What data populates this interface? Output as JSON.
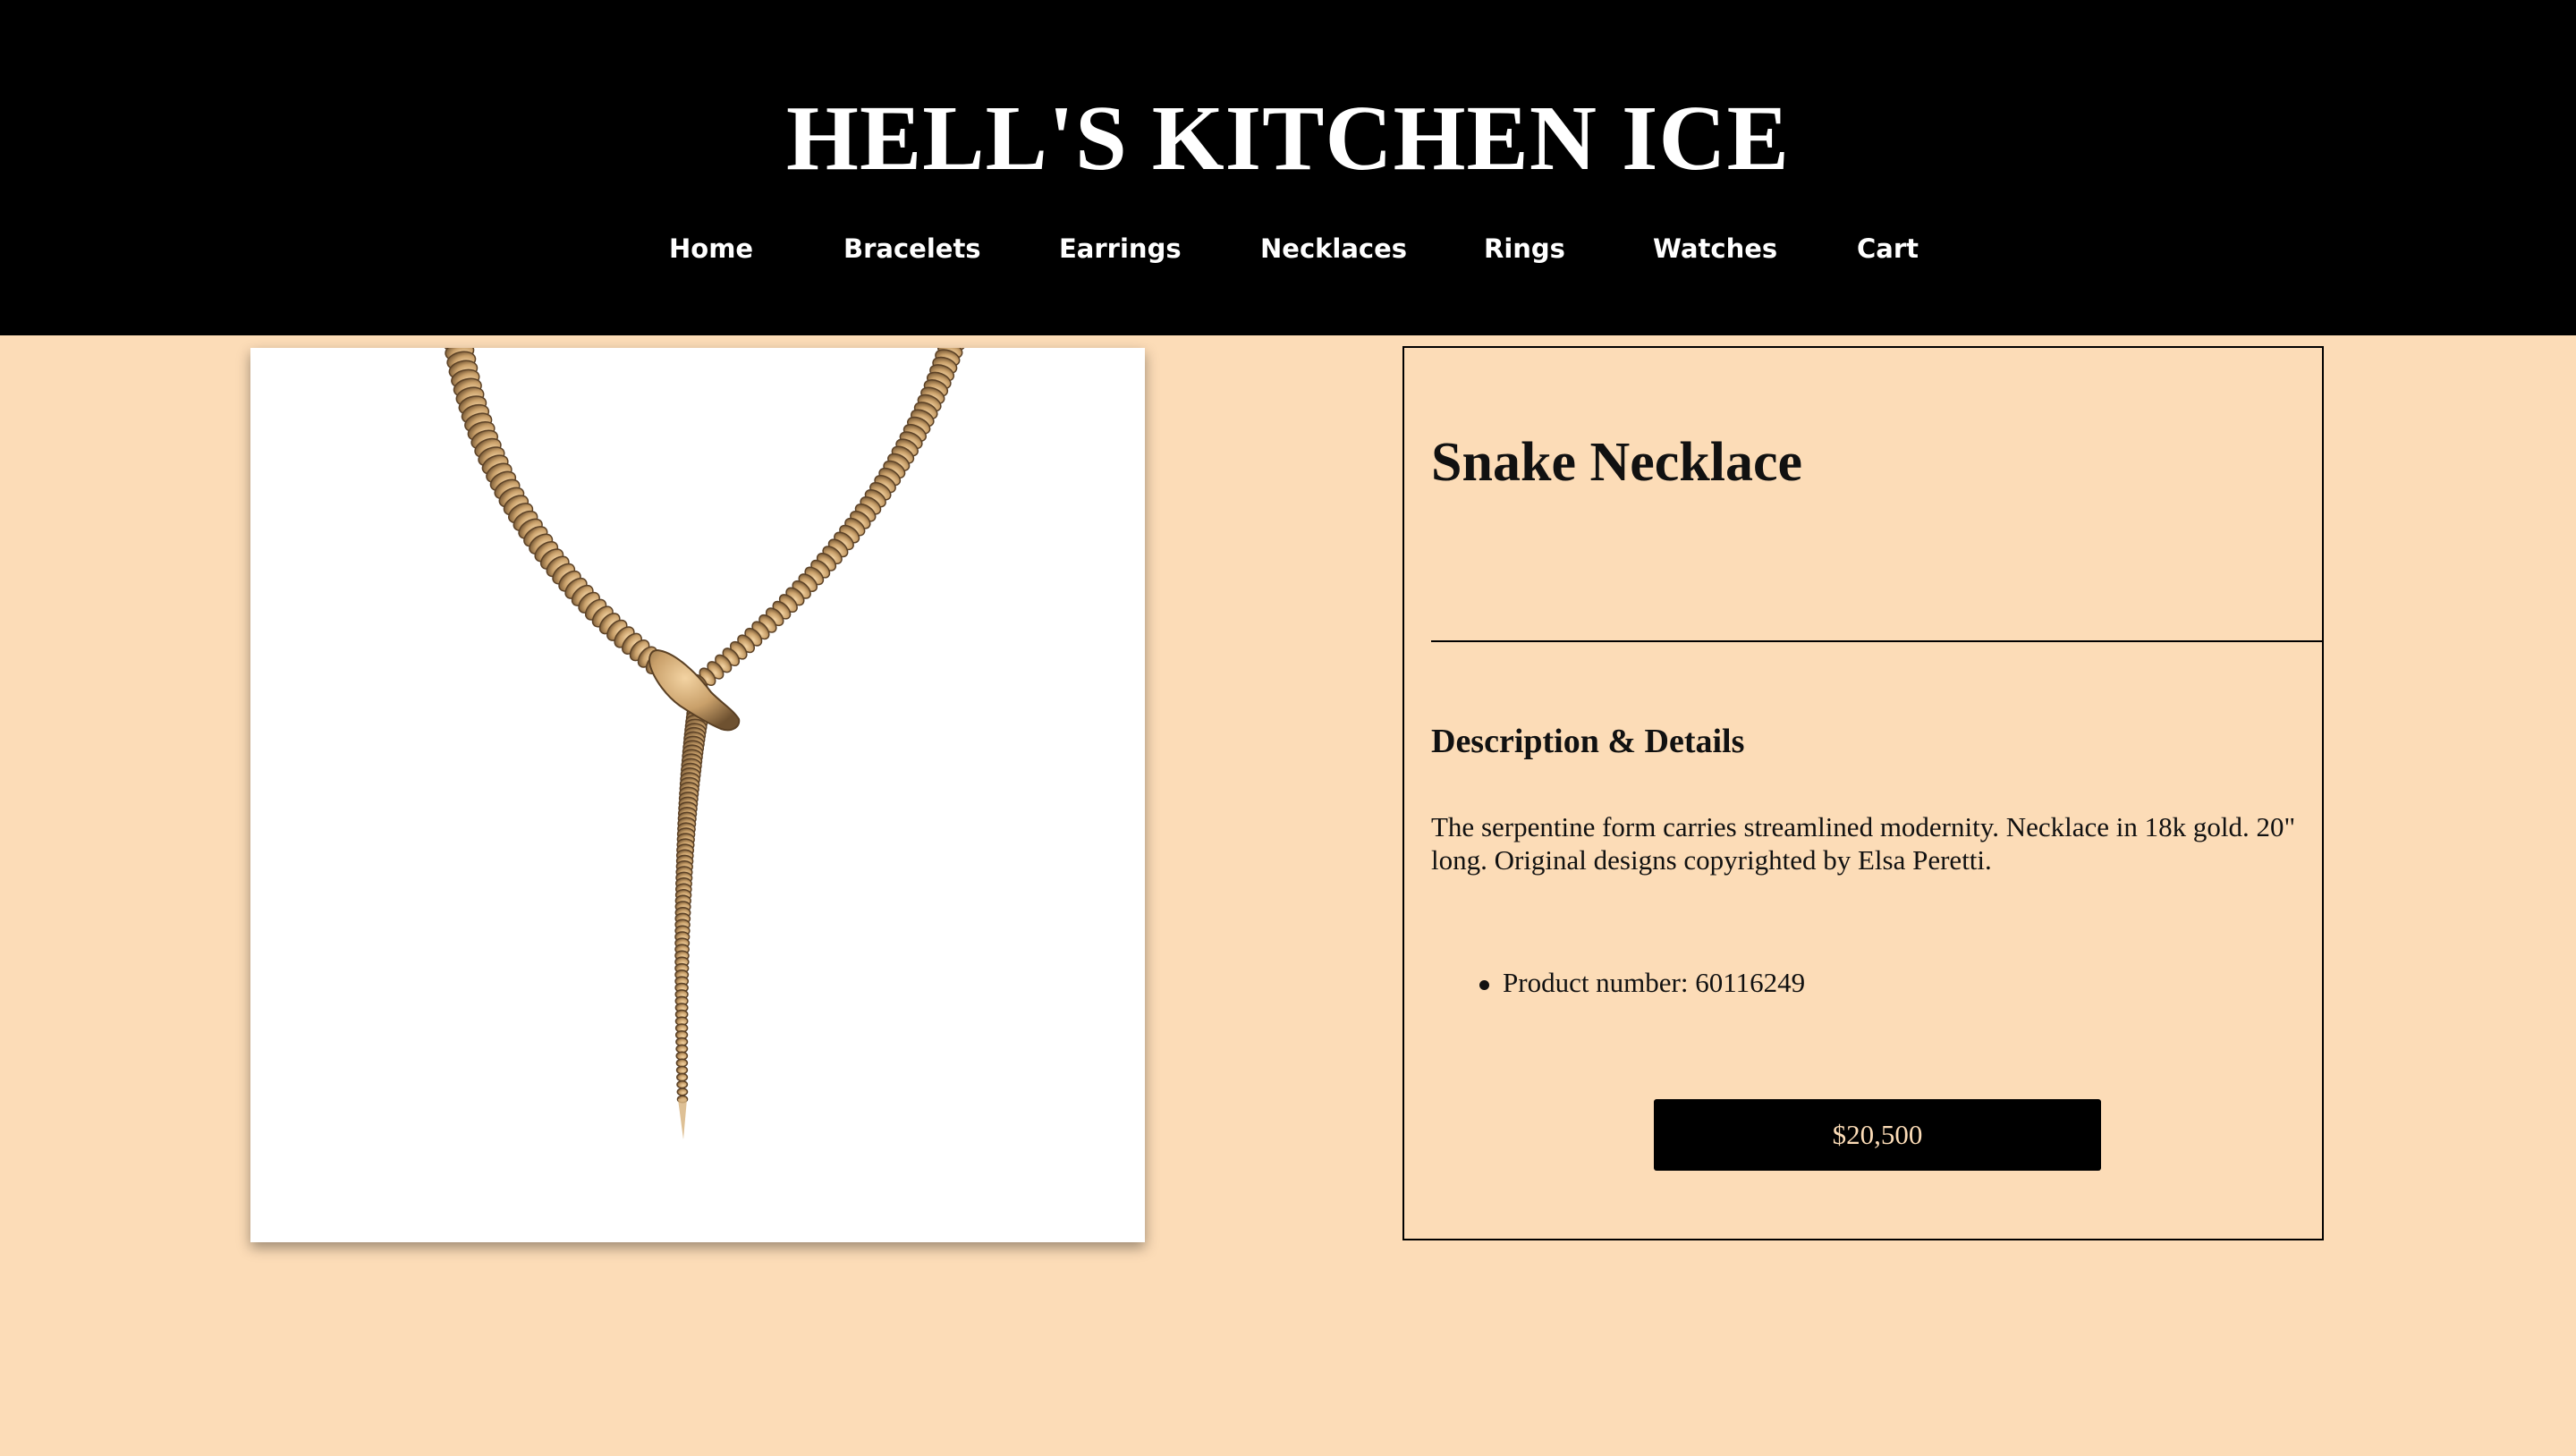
{
  "site": {
    "title": "HELL'S KITCHEN ICE"
  },
  "nav": {
    "items": [
      {
        "label": "Home"
      },
      {
        "label": "Bracelets"
      },
      {
        "label": "Earrings"
      },
      {
        "label": "Necklaces"
      },
      {
        "label": "Rings"
      },
      {
        "label": "Watches"
      },
      {
        "label": "Cart"
      }
    ]
  },
  "product": {
    "title": "Snake Necklace",
    "details_heading": "Description & Details",
    "description": "The serpentine form carries streamlined modernity. Necklace in 18k gold. 20\" long. Original designs copyrighted by Elsa Peretti.",
    "specs": [
      {
        "text": "Product number: 60116249"
      }
    ],
    "price_label": "$20,500",
    "image_icon": "necklace-image"
  },
  "colors": {
    "background": "#fcdcb7",
    "header": "#000000",
    "gold": "#c9a06a"
  }
}
